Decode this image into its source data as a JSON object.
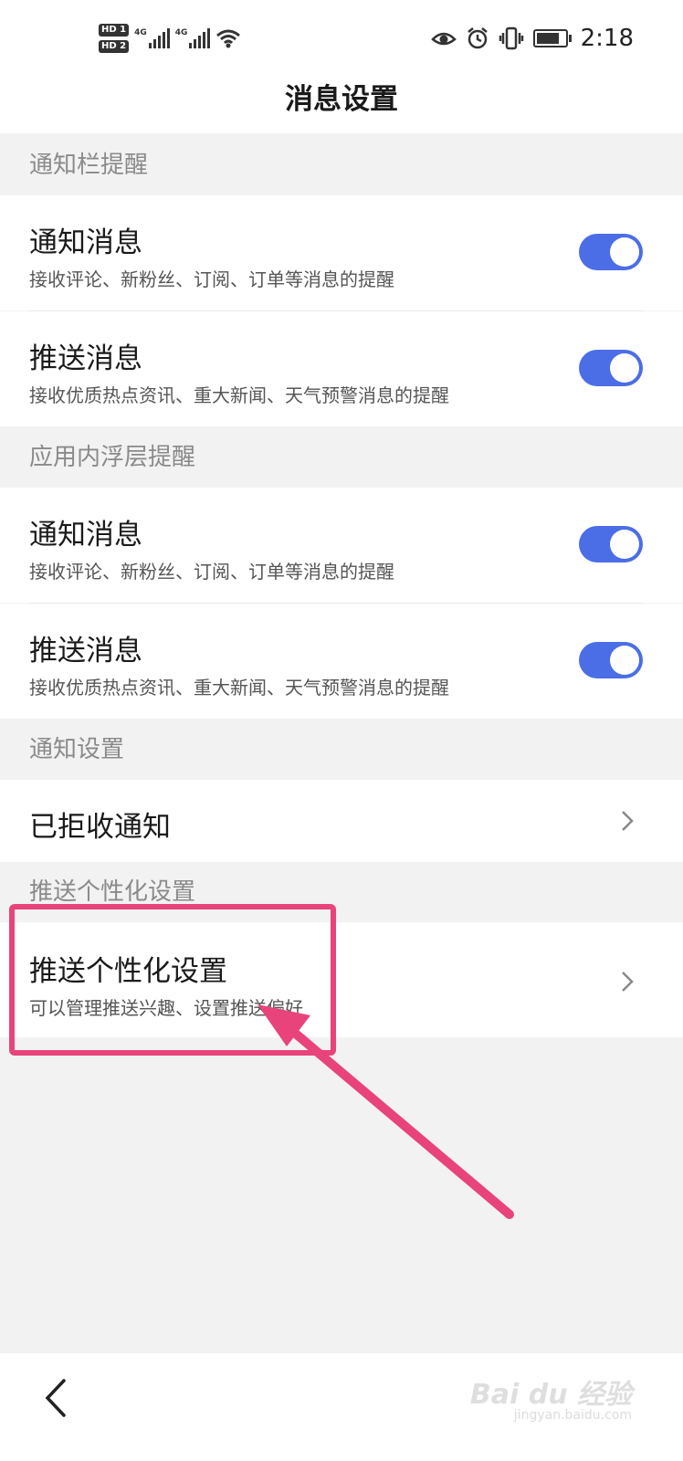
{
  "status_bar": {
    "hd1": "HD 1",
    "hd2": "HD 2",
    "net1": "4G",
    "net2": "4G",
    "time": "2:18",
    "icons": [
      "eye-icon",
      "alarm-icon",
      "vibrate-icon",
      "battery-icon",
      "wifi-icon"
    ]
  },
  "page": {
    "title": "消息设置"
  },
  "sections": {
    "notification_bar": {
      "header": "通知栏提醒",
      "item1": {
        "title": "通知消息",
        "subtitle": "接收评论、新粉丝、订阅、订单等消息的提醒",
        "enabled": true
      },
      "item2": {
        "title": "推送消息",
        "subtitle": "接收优质热点资讯、重大新闻、天气预警消息的提醒",
        "enabled": true
      }
    },
    "in_app_overlay": {
      "header": "应用内浮层提醒",
      "item1": {
        "title": "通知消息",
        "subtitle": "接收评论、新粉丝、订阅、订单等消息的提醒",
        "enabled": true
      },
      "item2": {
        "title": "推送消息",
        "subtitle": "接收优质热点资讯、重大新闻、天气预警消息的提醒",
        "enabled": true
      }
    },
    "notification_settings": {
      "header": "通知设置",
      "item1": {
        "title": "已拒收通知"
      }
    },
    "push_personalization": {
      "header": "推送个性化设置",
      "item1": {
        "title": "推送个性化设置",
        "subtitle": "可以管理推送兴趣、设置推送偏好"
      }
    }
  },
  "watermark": {
    "brand": "Bai du 经验",
    "url": "jingyan.baidu.com"
  },
  "colors": {
    "toggle_on": "#4b6de6",
    "annotation": "#e8437b",
    "background": "#f2f2f2"
  }
}
